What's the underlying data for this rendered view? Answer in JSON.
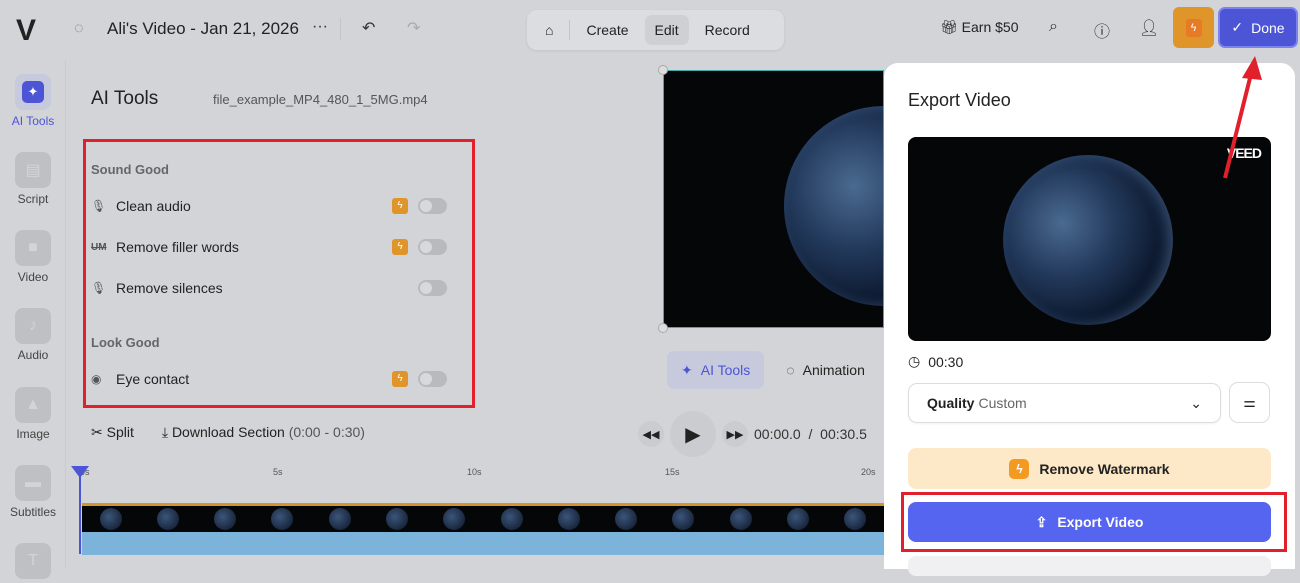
{
  "header": {
    "logo": "V",
    "project_title": "Ali's Video - Jan 21, 2026",
    "more": "···",
    "undo": "↶",
    "redo": "↷",
    "home_icon": "⌂",
    "modes": [
      "Create",
      "Edit",
      "Record"
    ],
    "active_mode": "Edit",
    "earn": "Earn $50",
    "done": "Done"
  },
  "nav": [
    {
      "label": "AI Tools",
      "icon": "✦"
    },
    {
      "label": "Script",
      "icon": "▤"
    },
    {
      "label": "Video",
      "icon": "■"
    },
    {
      "label": "Audio",
      "icon": "♪"
    },
    {
      "label": "Image",
      "icon": "▲"
    },
    {
      "label": "Subtitles",
      "icon": "▬"
    },
    {
      "label": "",
      "icon": "T"
    }
  ],
  "panel": {
    "title": "AI Tools",
    "filename": "file_example_MP4_480_1_5MG.mp4",
    "sections": [
      {
        "title": "Sound Good",
        "items": [
          {
            "label": "Clean audio",
            "icon": "🎙",
            "premium": true,
            "on": false
          },
          {
            "label": "Remove filler words",
            "icon": "UM",
            "premium": true,
            "on": false
          },
          {
            "label": "Remove silences",
            "icon": "🎙",
            "premium": false,
            "on": false
          }
        ]
      },
      {
        "title": "Look Good",
        "items": [
          {
            "label": "Eye contact",
            "icon": "◉",
            "premium": true,
            "on": false
          }
        ]
      }
    ]
  },
  "preview_tabs": [
    {
      "label": "AI Tools",
      "icon": "✦"
    },
    {
      "label": "Animation",
      "icon": "◌"
    }
  ],
  "timeline": {
    "split": "Split",
    "download": "Download Section",
    "range": "(0:00 - 0:30)",
    "current": "00:00.0",
    "sep": "/",
    "total": "00:30.5",
    "ticks": [
      "0s",
      "5s",
      "10s",
      "15s",
      "20s"
    ]
  },
  "export": {
    "title": "Export Video",
    "watermark": "VEED",
    "duration": "00:30",
    "quality_label": "Quality",
    "quality_value": "Custom",
    "remove_watermark": "Remove Watermark",
    "export_button": "Export Video"
  },
  "colors": {
    "accent": "#4c55d6",
    "export": "#5565f0",
    "premium": "#e0952a",
    "highlight": "#e0202a"
  }
}
